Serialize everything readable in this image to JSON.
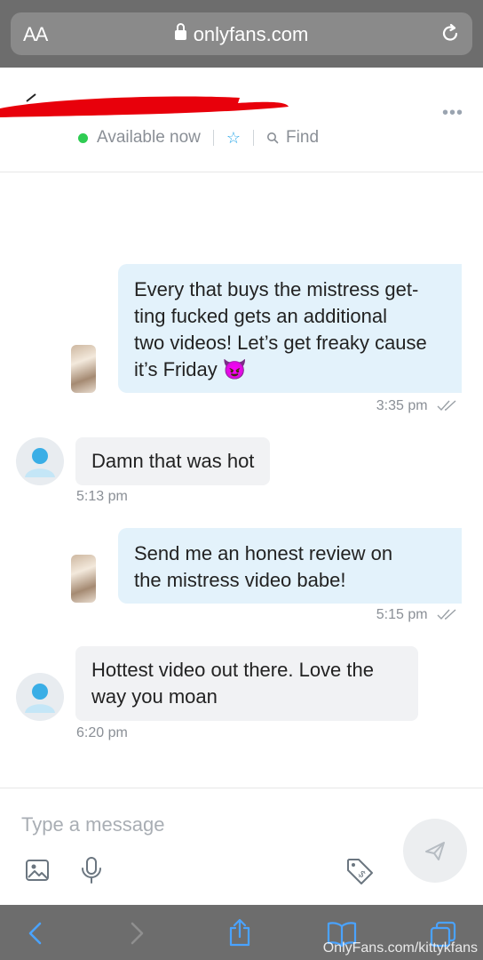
{
  "browser": {
    "text_size_label": "AA",
    "url": "onlyfans.com"
  },
  "header": {
    "status": "Available now",
    "find_label": "Find"
  },
  "messages": [
    {
      "direction": "out",
      "text": "Every that buys the mistress get-ting fucked gets an additional two videos! Let’s get freaky cause it’s Friday 😈",
      "lines": [
        "Every that buys the mistress get-",
        "ting fucked gets an additional",
        "two videos! Let’s get freaky cause",
        "it’s Friday 😈"
      ],
      "time": "3:35 pm"
    },
    {
      "direction": "in",
      "text": "Damn that was hot",
      "time": "5:13 pm"
    },
    {
      "direction": "out",
      "lines": [
        "Send me an honest review on",
        "the mistress video babe!"
      ],
      "time": "5:15 pm"
    },
    {
      "direction": "in",
      "lines": [
        "Hottest video out there. Love the",
        "way you moan"
      ],
      "time": "6:20 pm"
    }
  ],
  "composer": {
    "placeholder": "Type a message"
  },
  "watermark": "OnlyFans.com/kittykfans",
  "colors": {
    "outgoing_bubble": "#e3f2fb",
    "incoming_bubble": "#f1f2f4",
    "online_dot": "#2ecc52",
    "accent": "#2aa7e8",
    "redaction": "#e8000b"
  }
}
